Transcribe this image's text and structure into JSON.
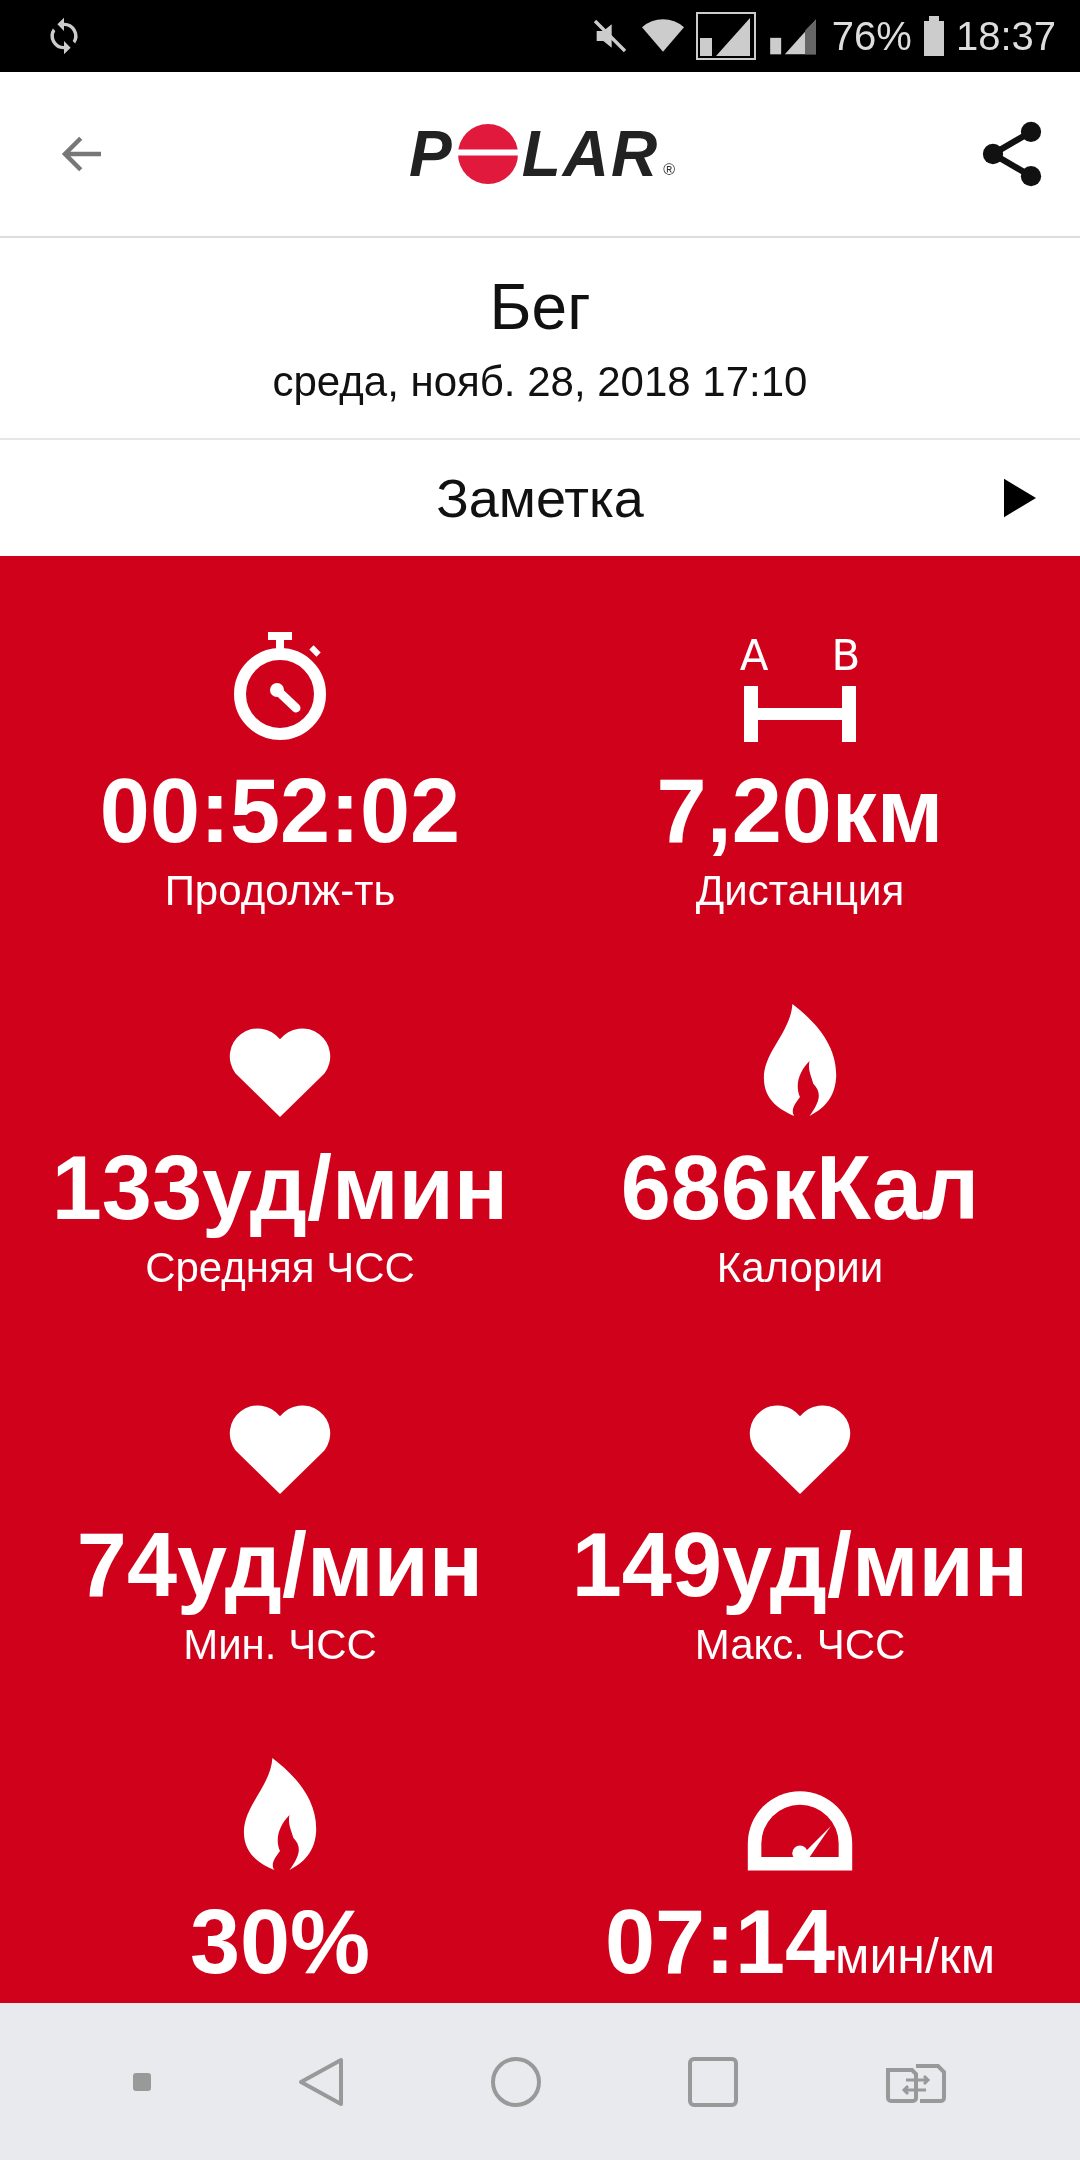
{
  "status_bar": {
    "battery": "76%",
    "time": "18:37"
  },
  "header": {
    "logo": {
      "before": "P",
      "after": "LAR",
      "mark": "®"
    }
  },
  "activity": {
    "title": "Бег",
    "datetime": "среда, нояб. 28, 2018 17:10"
  },
  "note": {
    "label": "Заметка"
  },
  "distance_icon": {
    "letters": [
      "A",
      "B"
    ]
  },
  "metrics": [
    {
      "kind": "duration",
      "value": "00:52:02",
      "label": "Продолж-ть"
    },
    {
      "kind": "distance",
      "value": "7,20км",
      "label": "Дистанция"
    },
    {
      "kind": "heart",
      "value": "133уд/мин",
      "label": "Средняя ЧСС"
    },
    {
      "kind": "flame",
      "value": "686кКал",
      "label": "Калории"
    },
    {
      "kind": "heart",
      "value": "74уд/мин",
      "label": "Мин. ЧСС"
    },
    {
      "kind": "heart",
      "value": "149уд/мин",
      "label": "Макс. ЧСС"
    },
    {
      "kind": "flame",
      "value": "30%"
    },
    {
      "kind": "pace",
      "value": "07:14",
      "unit": "мин/км"
    }
  ]
}
